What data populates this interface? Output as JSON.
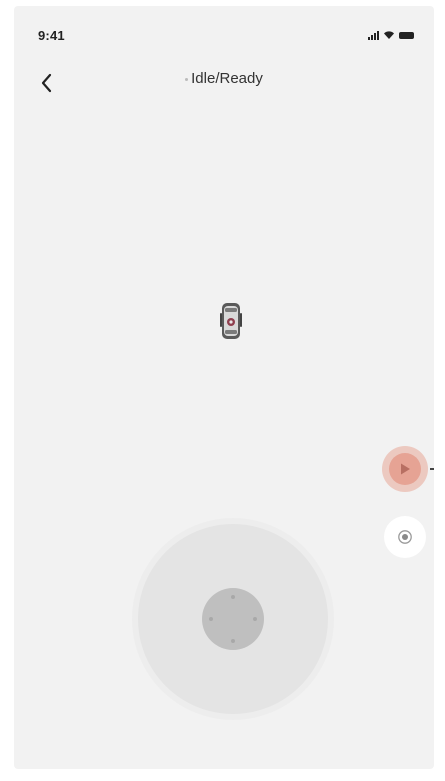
{
  "status_bar": {
    "time": "9:41",
    "icons": [
      "signal-icon",
      "wifi-icon",
      "battery-icon"
    ]
  },
  "nav": {
    "back_icon": "chevron-left-icon",
    "title": "Idle/Ready"
  },
  "robot": {
    "icon": "robot-icon"
  },
  "controls": {
    "play_icon": "play-icon",
    "record_icon": "record-icon"
  },
  "joystick": {
    "name": "joystick"
  },
  "colors": {
    "background": "#f2f2f2",
    "accent_play": "#e6a394",
    "joystick_base": "#e4e4e4",
    "joystick_knob": "#bfbfbf"
  }
}
